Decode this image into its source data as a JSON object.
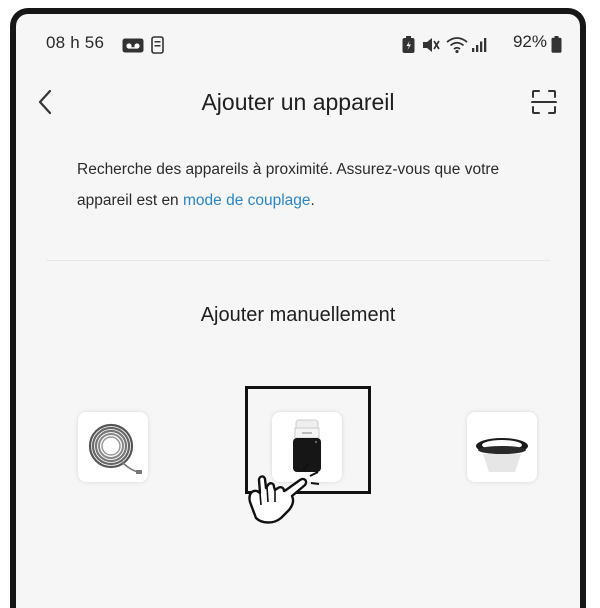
{
  "status_bar": {
    "time": "08 h 56",
    "battery": "92%",
    "icons": [
      "voicemail-icon",
      "phone-storage-icon",
      "battery-saver-icon",
      "mute-icon",
      "wifi-icon",
      "signal-icon",
      "battery-icon"
    ]
  },
  "header": {
    "title": "Ajouter un appareil",
    "back_icon": "chevron-left-icon",
    "scan_icon": "qr-scan-icon"
  },
  "description": {
    "before_link": "Recherche des appareils à proximité. Assurez-vous que votre appareil est en ",
    "link": "mode de couplage",
    "after_link": "."
  },
  "manual": {
    "title": "Ajouter manuellement",
    "devices": [
      {
        "icon": "led-strip-icon",
        "selected": false
      },
      {
        "icon": "smart-plug-icon",
        "selected": true
      },
      {
        "icon": "recessed-light-icon",
        "selected": false
      }
    ]
  },
  "colors": {
    "background": "#f6f6f6",
    "link": "#2b86c5",
    "frame": "#161616"
  }
}
